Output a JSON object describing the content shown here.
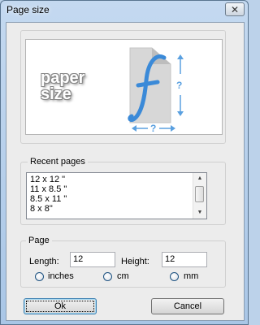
{
  "window": {
    "title": "Page size",
    "close_glyph": "✕"
  },
  "preview": {
    "paper_label_line1": "paper",
    "paper_label_line2": "size",
    "height_placeholder": "?",
    "width_placeholder": "?",
    "logo_glyph": "f"
  },
  "recent": {
    "legend": "Recent pages",
    "items": [
      "12 x 12 \"",
      "11 x 8.5 \"",
      "8.5 x 11 \"",
      "8 x 8\""
    ]
  },
  "page": {
    "legend": "Page",
    "length_label": "Length:",
    "length_value": "12",
    "height_label": "Height:",
    "height_value": "12",
    "units": [
      {
        "label": "inches",
        "selected": false
      },
      {
        "label": "cm",
        "selected": false
      },
      {
        "label": "mm",
        "selected": false
      }
    ]
  },
  "buttons": {
    "ok": "Ok",
    "cancel": "Cancel"
  },
  "colors": {
    "titlebar": "#bcd2ea",
    "accent_blue": "#3b8ad8"
  }
}
